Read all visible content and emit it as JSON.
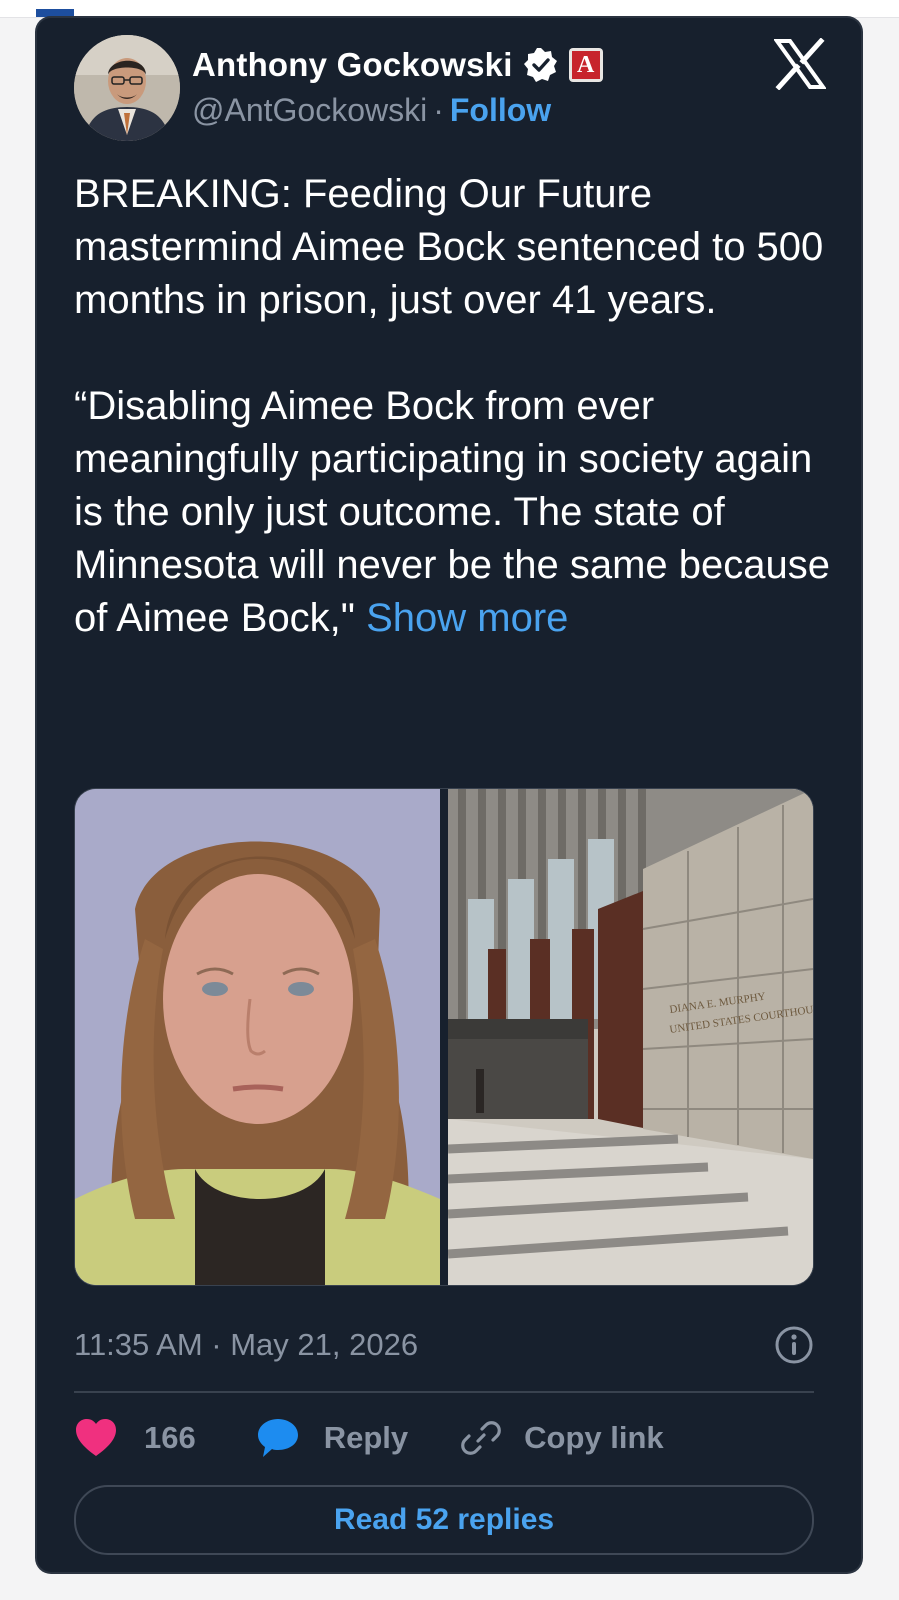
{
  "author": {
    "name": "Anthony Gockowski",
    "handle": "@AntGockowski",
    "separator": "·",
    "follow_label": "Follow",
    "verified_icon": "verified-badge-icon",
    "affiliate_badge": "A"
  },
  "tweet": {
    "paragraph_1": "BREAKING: Feeding Our Future mastermind Aimee Bock sentenced to 500 months in prison, just over 41 years.",
    "paragraph_2": "“Disabling Aimee Bock from ever meaningfully participating in society again is the only just outcome. The state of Minnesota will never be the same because of Aimee Bock,\"",
    "show_more": "Show more"
  },
  "media": {
    "building_sign_line_1": "DIANA E. MURPHY",
    "building_sign_line_2": "UNITED STATES COURTHOUSE"
  },
  "timestamp": "11:35 AM · May 21, 2026",
  "actions": {
    "likes_count": "166",
    "reply_label": "Reply",
    "copy_link_label": "Copy link"
  },
  "read_replies_label": "Read 52 replies",
  "colors": {
    "card_background": "#17202d",
    "link_blue": "#4aa3ef",
    "like_pink": "#f0307f",
    "reply_blue": "#1d8cf0",
    "muted_text": "#8a94a3"
  }
}
